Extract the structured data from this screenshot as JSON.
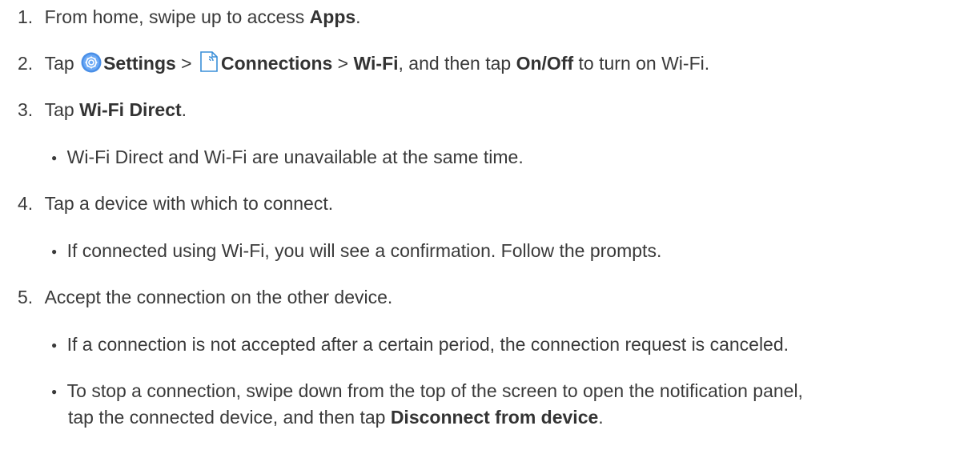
{
  "steps": [
    {
      "num": "1.",
      "parts": [
        "From home, swipe up to access ",
        "Apps",
        "."
      ]
    },
    {
      "num": "2.",
      "parts": [
        "Tap ",
        "Settings",
        " > ",
        "Connections",
        " > ",
        "Wi-Fi",
        ", and then tap ",
        "On/Off",
        " to turn on Wi-Fi."
      ],
      "icons": [
        "settings-gear-icon",
        "connections-icon"
      ]
    },
    {
      "num": "3.",
      "parts": [
        "Tap ",
        "Wi-Fi Direct",
        "."
      ],
      "bullets": [
        "Wi-Fi Direct and Wi-Fi are unavailable at the same time."
      ]
    },
    {
      "num": "4.",
      "parts": [
        "Tap a device with which to connect."
      ],
      "bullets": [
        "If connected using Wi-Fi, you will see a confirmation. Follow the prompts."
      ]
    },
    {
      "num": "5.",
      "parts": [
        "Accept the connection on the other device."
      ],
      "bullets": [
        "If a connection is not accepted after a certain period, the connection request is canceled.",
        "To stop a connection, swipe down from the top of the screen to open the notification panel,"
      ],
      "bullet2_cont_parts": [
        "tap the connected device, and then tap ",
        "Disconnect from device",
        "."
      ]
    }
  ],
  "bullet_glyph": "●",
  "colors": {
    "text": "#3a3a3a",
    "settings_icon": "#4a8fe7",
    "connections_icon": "#3a8fd9"
  }
}
